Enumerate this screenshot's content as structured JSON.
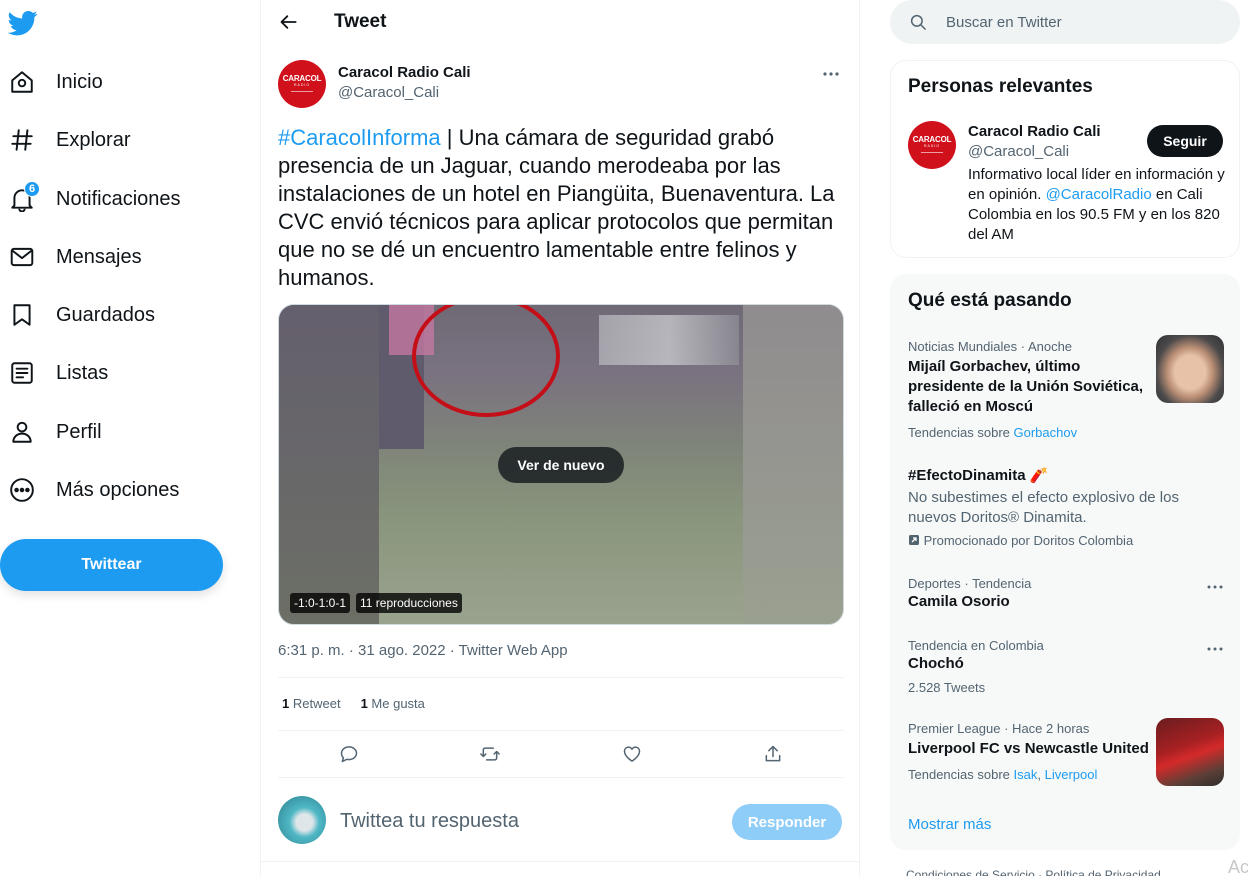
{
  "nav": {
    "logo_icon": "twitter-bird-icon",
    "items": [
      {
        "label": "Inicio",
        "icon": "home-icon"
      },
      {
        "label": "Explorar",
        "icon": "hashtag-icon"
      },
      {
        "label": "Notificaciones",
        "icon": "bell-icon",
        "badge": "6"
      },
      {
        "label": "Mensajes",
        "icon": "envelope-icon"
      },
      {
        "label": "Guardados",
        "icon": "bookmark-icon"
      },
      {
        "label": "Listas",
        "icon": "list-icon"
      },
      {
        "label": "Perfil",
        "icon": "person-icon"
      },
      {
        "label": "Más opciones",
        "icon": "more-circle-icon"
      }
    ],
    "tweet_button": "Twittear"
  },
  "header": {
    "title": "Tweet"
  },
  "tweet": {
    "author_name": "Caracol Radio Cali",
    "author_handle": "@Caracol_Cali",
    "avatar_text": "CARACOL",
    "avatar_subtext": "RADIO",
    "hashtag": "#CaracolInforma",
    "text": " | Una cámara de seguridad grabó presencia de un Jaguar, cuando merodeaba por las instalaciones de un hotel en Piangüita, Buenaventura. La CVC envió técnicos para aplicar protocolos que permitan que no se dé un encuentro lamentable entre felinos y humanos.",
    "media": {
      "replay_label": "Ver de nuevo",
      "time_tag": "-1:0-1:0-1",
      "views_tag": "11 reproducciones"
    },
    "meta": "6:31 p. m. · 31 ago. 2022 · Twitter Web App",
    "retweets_count": "1",
    "retweets_label": "Retweet",
    "likes_count": "1",
    "likes_label": "Me gusta"
  },
  "reply": {
    "placeholder": "Twittea tu respuesta",
    "button": "Responder"
  },
  "sidebar": {
    "search_placeholder": "Buscar en Twitter",
    "relevant": {
      "title": "Personas relevantes",
      "name": "Caracol Radio Cali",
      "handle": "@Caracol_Cali",
      "follow": "Seguir",
      "bio_pre": "Informativo local líder en información y en opinión. ",
      "bio_link": "@CaracolRadio",
      "bio_post": " en Cali Colombia en los 90.5 FM y en los 820 del AM"
    },
    "trends": {
      "title": "Qué está pasando",
      "items": [
        {
          "context": "Noticias Mundiales · Anoche",
          "title": "Mijaíl Gorbachev, último presidente de la Unión Soviética, falleció en Moscú",
          "sub_pre": "Tendencias sobre ",
          "sub_links": [
            "Gorbachov"
          ]
        },
        {
          "title": "#EfectoDinamita 🧨",
          "body": "No subestimes el efecto explosivo de los nuevos Doritos® Dinamita.",
          "promo": "Promocionado por Doritos Colombia"
        },
        {
          "context": "Deportes · Tendencia",
          "title": "Camila Osorio"
        },
        {
          "context": "Tendencia en Colombia",
          "title": "Chochó",
          "sub": "2.528 Tweets"
        },
        {
          "context": "Premier League · Hace 2 horas",
          "title": "Liverpool FC vs Newcastle United",
          "sub_pre": "Tendencias sobre ",
          "sub_links": [
            "Isak",
            "Liverpool"
          ]
        }
      ],
      "show_more": "Mostrar más"
    },
    "footer": "Condiciones de Servicio · Política de Privacidad",
    "corner": "Ac"
  },
  "colors": {
    "accent": "#1d9bf0",
    "text": "#0f1419",
    "muted": "#536471",
    "brand_red": "#d0101b"
  }
}
